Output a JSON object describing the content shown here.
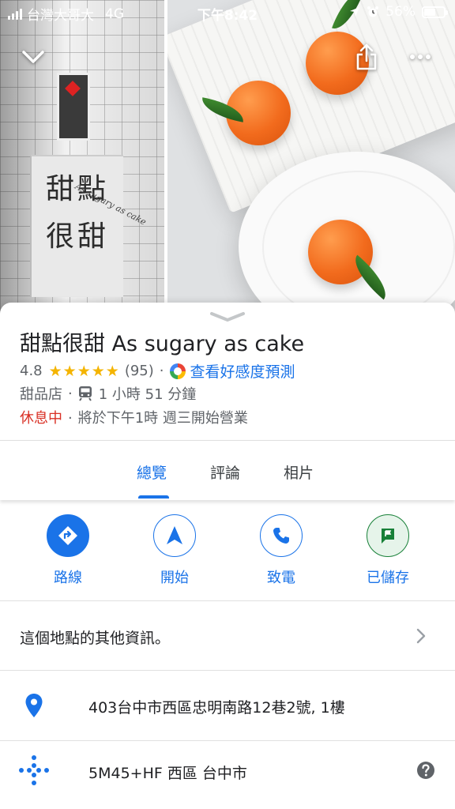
{
  "status_bar": {
    "carrier": "台灣大哥大",
    "network": "4G",
    "time": "下午8:42",
    "battery": "56%"
  },
  "header": {
    "photo_left": {
      "sign_line_1": "甜點",
      "sign_line_2": "很甜",
      "sign_script": "As sugary as cake"
    },
    "icons": [
      "chevron-down-icon",
      "share-icon",
      "more-icon"
    ]
  },
  "place": {
    "name": "甜點很甜 As sugary as cake",
    "rating": "4.8",
    "stars": "★★★★★",
    "review_count": "(95)",
    "sentiment_link": "查看好感度預測",
    "category": "甜品店",
    "transit_time": "1 小時 51 分鐘",
    "status": "休息中",
    "hours_info": "將於下午1時 週三開始營業"
  },
  "tabs": [
    {
      "label": "總覽",
      "active": true
    },
    {
      "label": "評論",
      "active": false
    },
    {
      "label": "相片",
      "active": false
    }
  ],
  "actions": [
    {
      "label": "路線",
      "icon": "directions-icon"
    },
    {
      "label": "開始",
      "icon": "navigation-icon"
    },
    {
      "label": "致電",
      "icon": "phone-icon"
    },
    {
      "label": "已儲存",
      "icon": "saved-flag-icon"
    }
  ],
  "info_rows": {
    "more_info": "這個地點的其他資訊。",
    "address": "403台中市西區忠明南路12巷2號, 1樓",
    "plus_code": "5M45+HF 西區 台中市"
  },
  "colors": {
    "accent": "#1a73e8",
    "closed": "#d93025",
    "star": "#f4b400",
    "saved": "#188038"
  }
}
